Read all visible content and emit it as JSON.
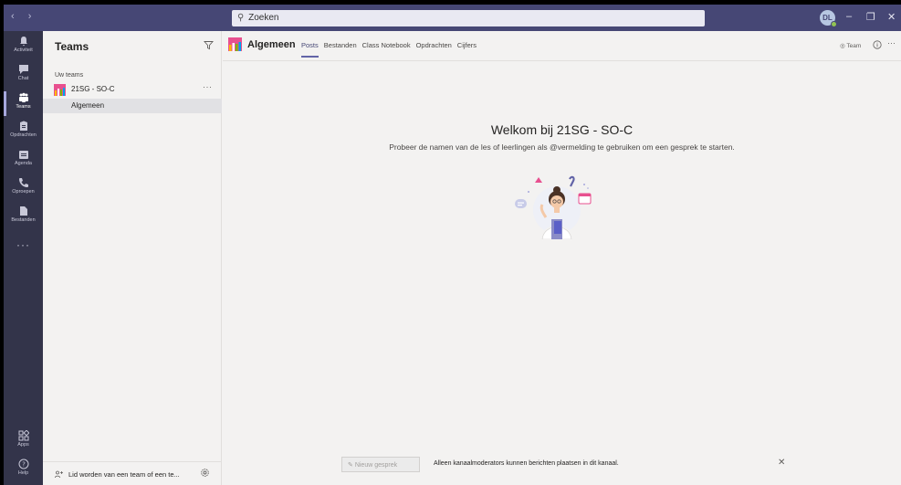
{
  "titlebar": {
    "nav_arrows": "‹ ›",
    "search_placeholder": "Zoeken",
    "avatar_initials": "DL",
    "window_controls": {
      "minimize": "–",
      "restore": "❐",
      "close": "✕"
    }
  },
  "rail": {
    "items": [
      {
        "label": "Activiteit",
        "icon": "bell-icon"
      },
      {
        "label": "Chat",
        "icon": "chat-icon"
      },
      {
        "label": "Teams",
        "icon": "teams-icon"
      },
      {
        "label": "Opdrachten",
        "icon": "assignments-icon"
      },
      {
        "label": "Agenda",
        "icon": "calendar-icon"
      },
      {
        "label": "Oproepen",
        "icon": "phone-icon"
      },
      {
        "label": "Bestanden",
        "icon": "files-icon"
      }
    ],
    "more": "···",
    "apps_label": "Apps",
    "help_label": "Help"
  },
  "teams_panel": {
    "title": "Teams",
    "section_label": "Uw teams",
    "team_name": "21SG - SO-C",
    "team_more": "···",
    "channel_name": "Algemeen",
    "footer_text": "Lid worden van een team of een te..."
  },
  "main": {
    "channel_title": "Algemeen",
    "tabs": [
      "Posts",
      "Bestanden",
      "Class Notebook",
      "Opdrachten",
      "Cijfers"
    ],
    "team_button": "Team",
    "more_button": "···",
    "welcome_title": "Welkom bij 21SG - SO-C",
    "welcome_subtitle": "Probeer de namen van de les of leerlingen als @vermelding te gebruiken om een gesprek te starten.",
    "new_conversation": "Nieuw gesprek",
    "moderator_note": "Alleen kanaalmoderators kunnen berichten plaatsen in dit kanaal.",
    "close": "✕"
  },
  "colors": {
    "titlebar": "#464775",
    "rail": "#33344a",
    "accent": "#6264a7",
    "team_logo": "#e8508f"
  }
}
